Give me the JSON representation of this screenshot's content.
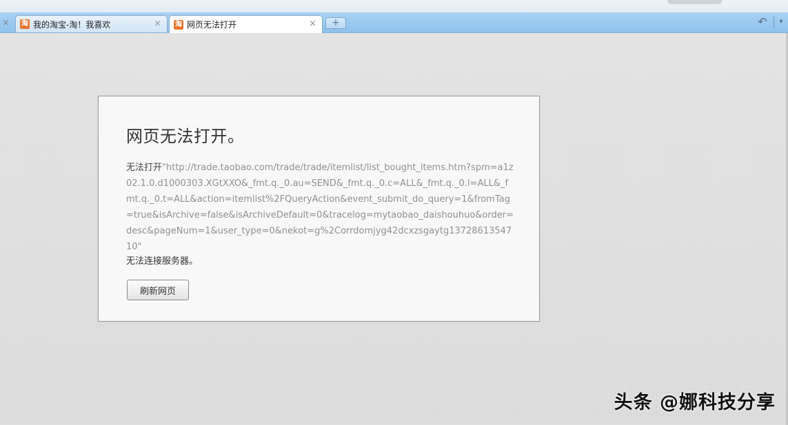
{
  "tabs": [
    {
      "title": "我的淘宝-淘！我喜欢",
      "favicon": "淘",
      "active": false
    },
    {
      "title": "网页无法打开",
      "favicon": "淘",
      "active": true
    }
  ],
  "tab_bar": {
    "close_glyph": "×",
    "new_tab_glyph": "+",
    "undo_glyph": "↶",
    "menu_glyph": "▾"
  },
  "error": {
    "title": "网页无法打开。",
    "prefix": "无法打开",
    "url": "\"http://trade.taobao.com/trade/trade/itemlist/list_bought_items.htm?spm=a1z02.1.0.d1000303.XGtXXO&_fmt.q._0.au=SEND&_fmt.q._0.c=ALL&_fmt.q._0.l=ALL&_fmt.q._0.t=ALL&action=itemlist%2FQueryAction&event_submit_do_query=1&fromTag=true&isArchive=false&isArchiveDefault=0&tracelog=mytaobao_daishouhuo&order=desc&pageNum=1&user_type=0&nekot=g%2Corrdomjyg42dcxzsgaytg1372861354710\"",
    "reason": "无法连接服务器。",
    "refresh_label": "刷新网页"
  },
  "watermark": "头条 @娜科技分享",
  "colors": {
    "tab_bar": "#9ccaf1",
    "favicon": "#e8762d",
    "panel_bg": "#f8f8f8",
    "page_bg": "#e0e0e0"
  }
}
